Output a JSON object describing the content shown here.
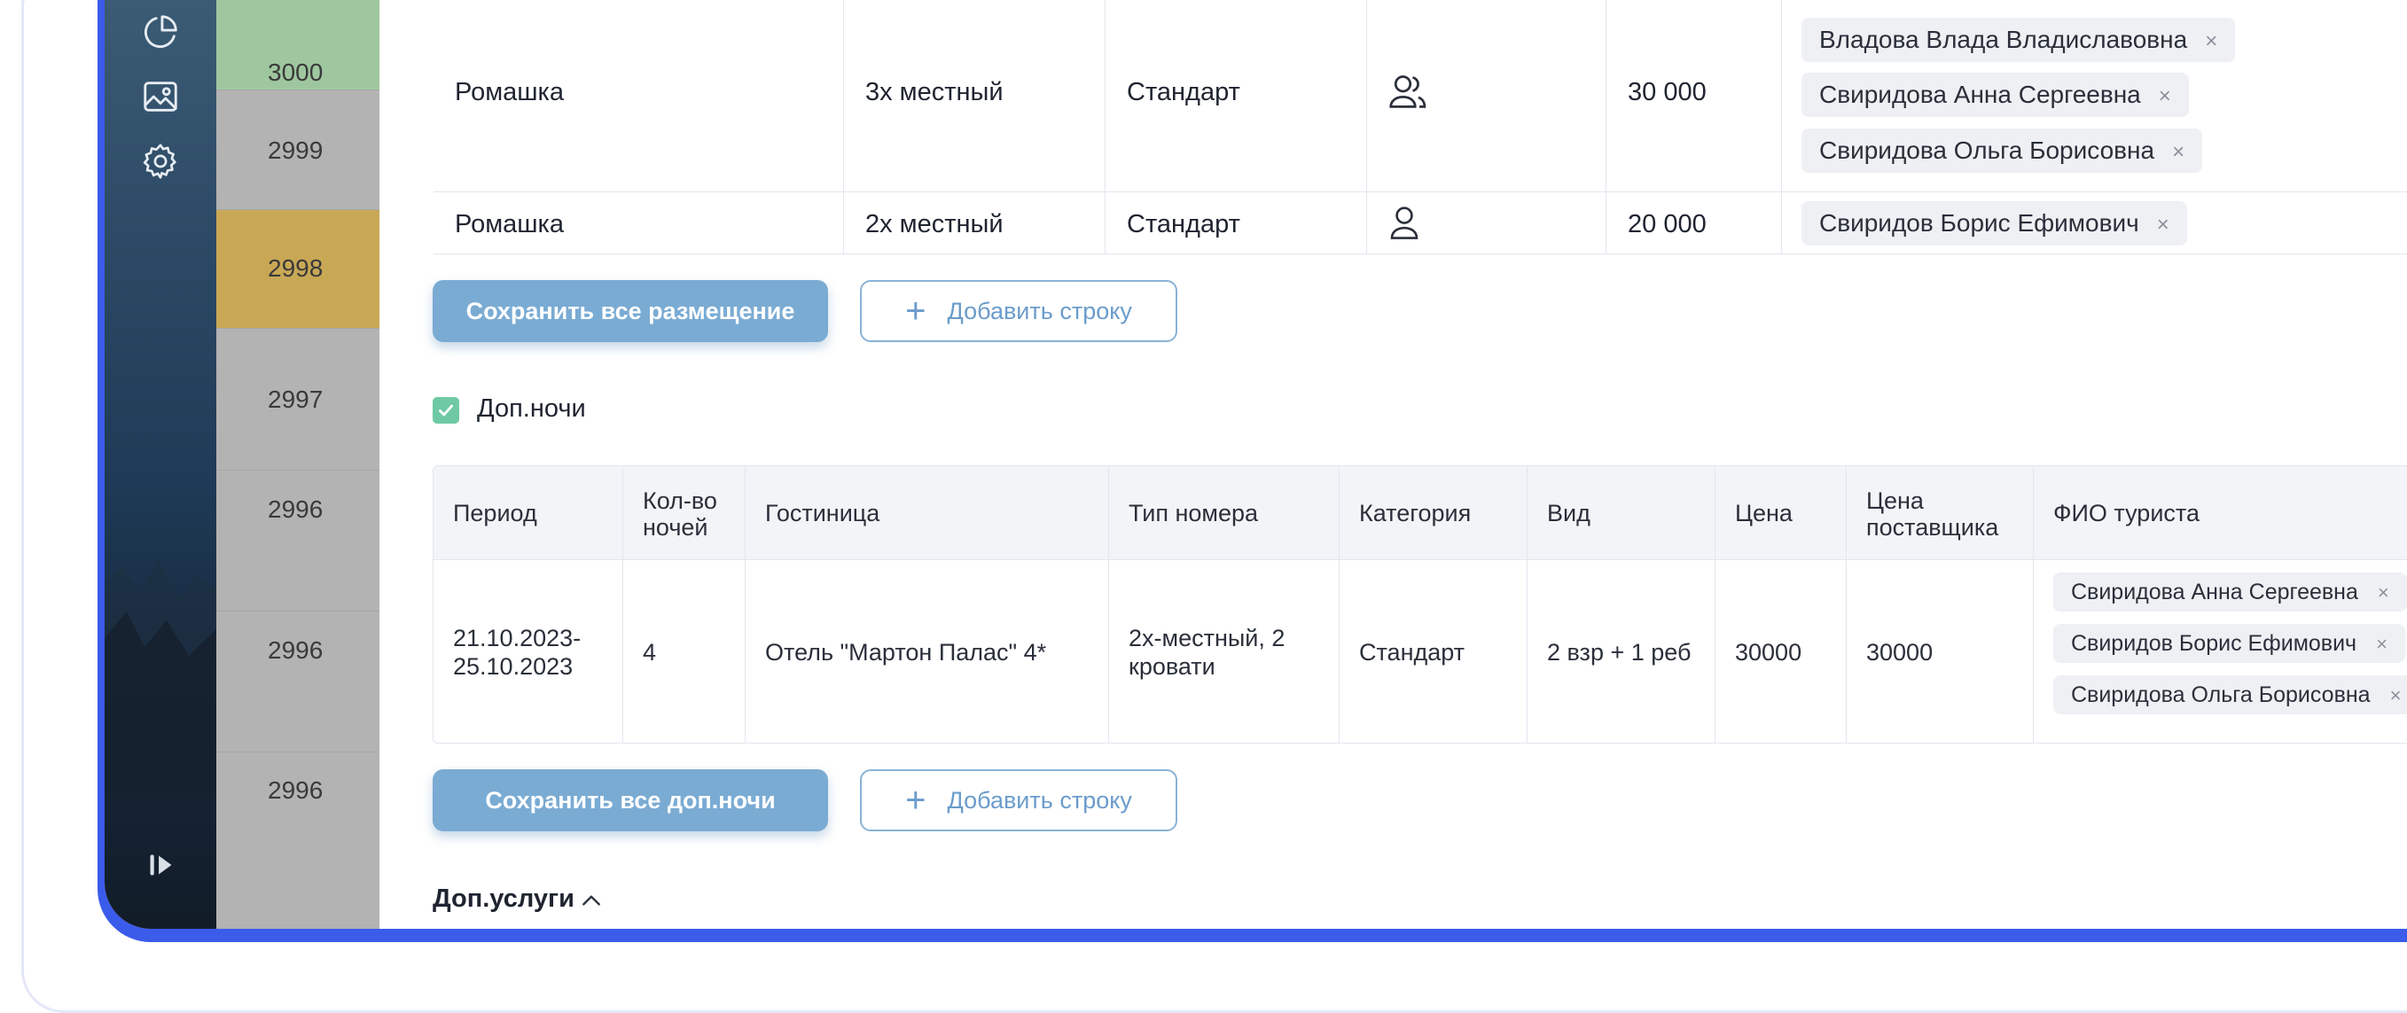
{
  "sidebar": {
    "icons": [
      "pie-chart-icon",
      "image-icon",
      "gear-icon",
      "expand-icon"
    ]
  },
  "number_column": {
    "items": [
      "3000",
      "2999",
      "2998",
      "2997",
      "2996",
      "2996",
      "2996"
    ]
  },
  "rooms": {
    "rows": [
      {
        "hotel": "Ромашка",
        "room_type": "3х местный",
        "category": "Стандарт",
        "icon": "users-icon",
        "price": "30 000",
        "tourists": [
          "Владова Влада Владиславовна",
          "Свиридова Анна Сергеевна",
          "Свиридова Ольга Борисовна"
        ]
      },
      {
        "hotel": "Ромашка",
        "room_type": "2х местный",
        "category": "Стандарт",
        "icon": "user-icon",
        "price": "20 000",
        "tourists": [
          "Свиридов Борис Ефимович"
        ]
      }
    ],
    "save_label": "Сохранить все размещение",
    "add_label": "Добавить строку",
    "remove_symbol": "×"
  },
  "extra_nights": {
    "checkbox_label": "Доп.ночи",
    "checked": true,
    "headers": {
      "period": "Период",
      "nights_count_1": "Кол-во",
      "nights_count_2": "ночей",
      "hotel": "Гостиница",
      "room_type": "Тип номера",
      "category": "Категория",
      "view": "Вид",
      "price": "Цена",
      "supplier_price_1": "Цена",
      "supplier_price_2": "поставщика",
      "tourist_name": "ФИО туриста"
    },
    "row": {
      "period_1": "21.10.2023-",
      "period_2": "25.10.2023",
      "nights": "4",
      "hotel": "Отель \"Мартон Палас\" 4*",
      "room_type_1": "2х-местный, 2",
      "room_type_2": "кровати",
      "category": "Стандарт",
      "view": "2 взр + 1 реб",
      "price": "30000",
      "supplier_price": "30000",
      "tourists": [
        "Свиридова Анна Сергеевна",
        "Свиридов Борис Ефимович",
        "Свиридова Ольга Борисовна"
      ]
    },
    "save_label": "Сохранить все доп.ночи",
    "add_label": "Добавить строку"
  },
  "extra_services": {
    "title": "Доп.услуги"
  },
  "colors": {
    "accent": "#3b5bea",
    "primary_button": "#7aabd3",
    "checkbox": "#6fc9a5",
    "highlight_green": "#9fc79f",
    "highlight_gold": "#c9a855"
  }
}
